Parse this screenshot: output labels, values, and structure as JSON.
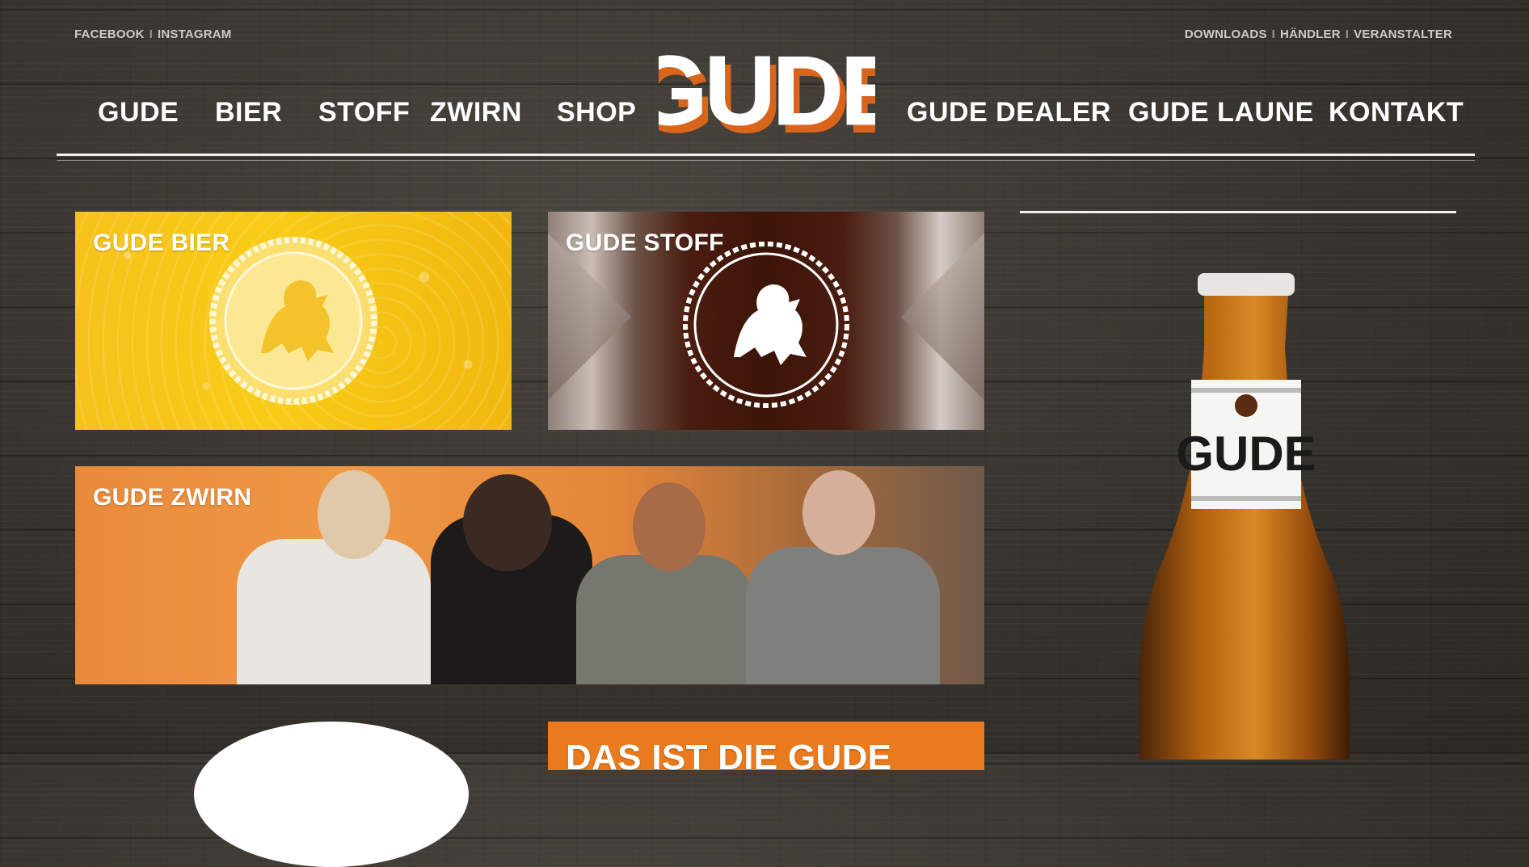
{
  "utility_left": {
    "links": [
      "FACEBOOK",
      "INSTAGRAM"
    ],
    "separator": "I"
  },
  "utility_right": {
    "links": [
      "DOWNLOADS",
      "HÄNDLER",
      "VERANSTALTER"
    ],
    "separator": "I"
  },
  "logo": {
    "text": "GUDE"
  },
  "nav": {
    "items": [
      "GUDE",
      "BIER",
      "STOFF",
      "ZWIRN",
      "SHOP",
      "GUDE DEALER",
      "GUDE LAUNE",
      "KONTAKT"
    ]
  },
  "tiles": {
    "bier": {
      "label": "GUDE BIER"
    },
    "stoff": {
      "label": "GUDE STOFF"
    },
    "zwirn": {
      "label": "GUDE ZWIRN"
    },
    "bottom": {
      "label": "DAS IST DIE GUDE"
    }
  },
  "bottle": {
    "label_text": "GUDE"
  },
  "colors": {
    "brand_orange": "#ea7a1e",
    "yellow": "#f8cc16",
    "cream": "#f2eee9",
    "wood": "#3a3631"
  }
}
